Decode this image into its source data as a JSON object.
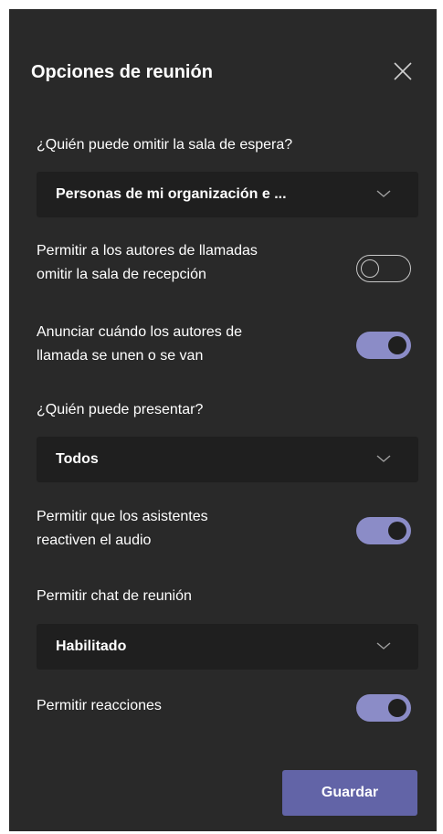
{
  "panel": {
    "title": "Opciones de reunión"
  },
  "options": {
    "lobby_bypass": {
      "label": "¿Quién puede omitir la sala de espera?",
      "selected": "Personas de mi organización e ..."
    },
    "callers_bypass": {
      "label_line1": "Permitir a los autores de llamadas",
      "label_line2": "omitir la sala de recepción",
      "enabled": false
    },
    "announce_callers": {
      "label_line1": "Anunciar cuándo los autores de",
      "label_line2": "llamada se unen o se van",
      "enabled": true
    },
    "presenters": {
      "label": "¿Quién puede presentar?",
      "selected": "Todos"
    },
    "attendee_unmute": {
      "label_line1": "Permitir que los asistentes",
      "label_line2": "reactiven el audio",
      "enabled": true
    },
    "meeting_chat": {
      "label": "Permitir chat de reunión",
      "selected": "Habilitado"
    },
    "reactions": {
      "label": "Permitir reacciones",
      "enabled": true
    }
  },
  "footer": {
    "save_label": "Guardar"
  },
  "colors": {
    "panel_bg": "#292929",
    "select_bg": "#1f1f1f",
    "toggle_on": "#8b8cc7",
    "primary_button": "#6264a7"
  },
  "icons": {
    "close": "close-icon",
    "dropdown": "chevron-down-icon"
  }
}
